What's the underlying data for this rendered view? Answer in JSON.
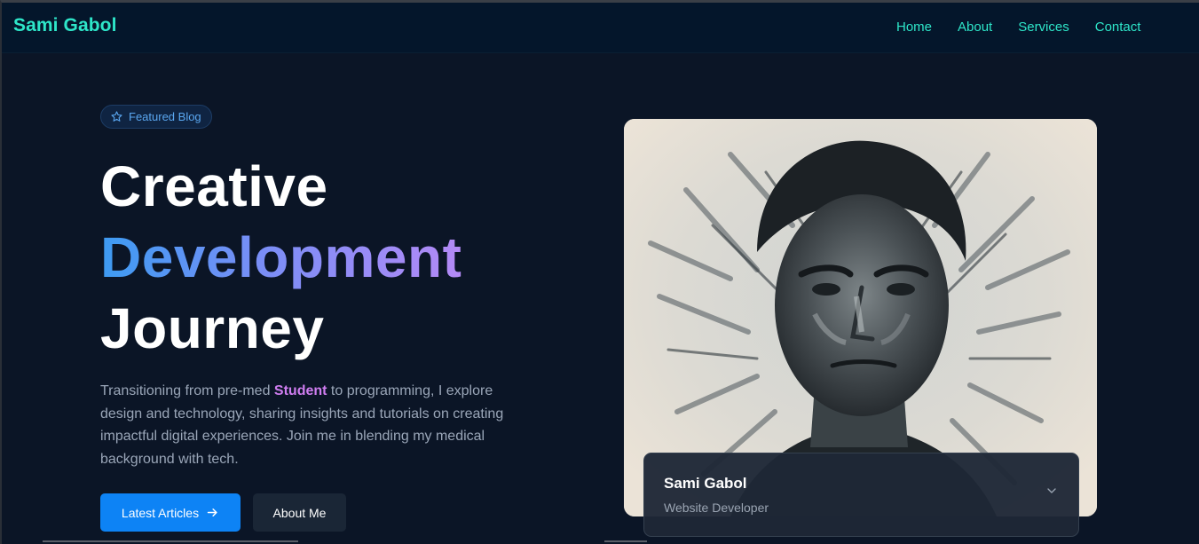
{
  "nav": {
    "brand": "Sami Gabol",
    "links": [
      {
        "label": "Home"
      },
      {
        "label": "About"
      },
      {
        "label": "Services"
      },
      {
        "label": "Contact"
      }
    ]
  },
  "hero": {
    "badge": {
      "icon": "star-icon",
      "label": "Featured Blog"
    },
    "headline": {
      "line1": "Creative",
      "line2": "Development",
      "line3": "Journey"
    },
    "intro": {
      "before": "Transitioning from pre-med ",
      "highlight": "Student",
      "after": " to programming, I explore design and technology, sharing insights and tutorials on creating impactful digital experiences. Join me in blending my medical background with tech."
    },
    "buttons": {
      "primary": {
        "label": "Latest Articles",
        "icon": "arrow-right-icon"
      },
      "secondary": {
        "label": "About Me"
      }
    }
  },
  "profile": {
    "name": "Sami Gabol",
    "role": "Website Developer",
    "toggle_icon": "chevron-down-icon"
  },
  "colors": {
    "background": "#0b1526",
    "navbar": "#04162b",
    "brand_accent": "#2ee6c9",
    "primary_button": "#0d83f5",
    "highlight": "#cf7df0"
  }
}
